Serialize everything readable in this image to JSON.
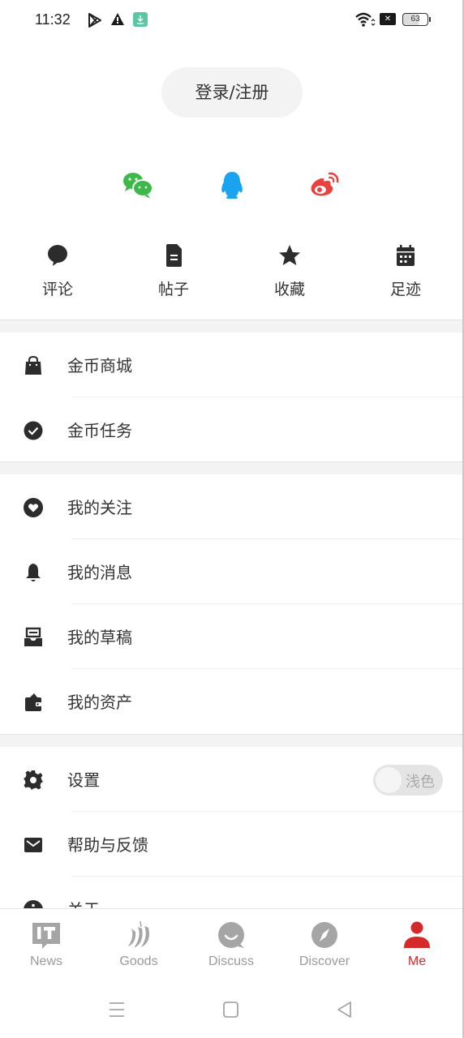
{
  "status_bar": {
    "time": "11:32",
    "battery": "63",
    "icons": [
      "play-store-icon",
      "warning-icon",
      "download-icon",
      "wifi-icon",
      "no-sim-icon",
      "battery-icon"
    ]
  },
  "login": {
    "label": "登录/注册"
  },
  "social": [
    {
      "name": "wechat",
      "icon": "wechat-icon",
      "color": "#3cb94a"
    },
    {
      "name": "qq",
      "icon": "qq-icon",
      "color": "#1aa3ef"
    },
    {
      "name": "weibo",
      "icon": "weibo-icon",
      "color": "#e8413e"
    }
  ],
  "quick": [
    {
      "label": "评论",
      "icon": "comment-icon"
    },
    {
      "label": "帖子",
      "icon": "document-icon"
    },
    {
      "label": "收藏",
      "icon": "star-icon"
    },
    {
      "label": "足迹",
      "icon": "calendar-icon"
    }
  ],
  "sections": [
    [
      {
        "label": "金币商城",
        "icon": "shopping-bag-icon"
      },
      {
        "label": "金币任务",
        "icon": "check-circle-icon"
      }
    ],
    [
      {
        "label": "我的关注",
        "icon": "heart-circle-icon"
      },
      {
        "label": "我的消息",
        "icon": "bell-icon"
      },
      {
        "label": "我的草稿",
        "icon": "inbox-icon"
      },
      {
        "label": "我的资产",
        "icon": "wallet-icon"
      }
    ],
    [
      {
        "label": "设置",
        "icon": "gear-icon",
        "toggle_label": "浅色",
        "toggle_on": false
      },
      {
        "label": "帮助与反馈",
        "icon": "mail-icon"
      },
      {
        "label": "关于",
        "icon": "info-icon"
      }
    ]
  ],
  "tabs": [
    {
      "label": "News",
      "icon": "it-news-icon",
      "active": false
    },
    {
      "label": "Goods",
      "icon": "chili-icon",
      "active": false
    },
    {
      "label": "Discuss",
      "icon": "chat-smile-icon",
      "active": false
    },
    {
      "label": "Discover",
      "icon": "compass-icon",
      "active": false
    },
    {
      "label": "Me",
      "icon": "person-icon",
      "active": true
    }
  ],
  "colors": {
    "accent": "#d42a2a",
    "icon_dark": "#333333",
    "tab_inactive": "#9a9a9a"
  }
}
